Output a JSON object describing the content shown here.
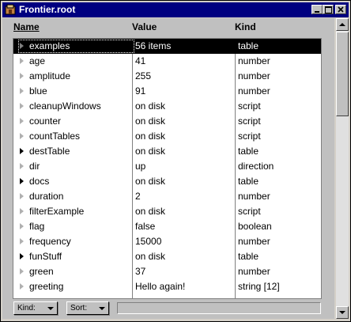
{
  "window": {
    "title": "Frontier.root",
    "title_bg": "#000080",
    "icon": "frontier-app-icon"
  },
  "columns": {
    "name": "Name",
    "value": "Value",
    "kind": "Kind"
  },
  "rows": [
    {
      "name": "examples",
      "value": "56 items",
      "kind": "table",
      "expandable": true,
      "selected": true
    },
    {
      "name": "age",
      "value": "41",
      "kind": "number",
      "expandable": false
    },
    {
      "name": "amplitude",
      "value": "255",
      "kind": "number",
      "expandable": false
    },
    {
      "name": "blue",
      "value": "91",
      "kind": "number",
      "expandable": false
    },
    {
      "name": "cleanupWindows",
      "value": "on disk",
      "kind": "script",
      "expandable": false
    },
    {
      "name": "counter",
      "value": "on disk",
      "kind": "script",
      "expandable": false
    },
    {
      "name": "countTables",
      "value": "on disk",
      "kind": "script",
      "expandable": false
    },
    {
      "name": "destTable",
      "value": "on disk",
      "kind": "table",
      "expandable": true
    },
    {
      "name": "dir",
      "value": "up",
      "kind": "direction",
      "expandable": false
    },
    {
      "name": "docs",
      "value": "on disk",
      "kind": "table",
      "expandable": true
    },
    {
      "name": "duration",
      "value": "2",
      "kind": "number",
      "expandable": false
    },
    {
      "name": "filterExample",
      "value": "on disk",
      "kind": "script",
      "expandable": false
    },
    {
      "name": "flag",
      "value": "false",
      "kind": "boolean",
      "expandable": false
    },
    {
      "name": "frequency",
      "value": "15000",
      "kind": "number",
      "expandable": false
    },
    {
      "name": "funStuff",
      "value": "on disk",
      "kind": "table",
      "expandable": true
    },
    {
      "name": "green",
      "value": "37",
      "kind": "number",
      "expandable": false
    },
    {
      "name": "greeting",
      "value": "Hello again!",
      "kind": "string [12]",
      "expandable": false
    }
  ],
  "bottom": {
    "kind_label": "Kind:",
    "sort_label": "Sort:"
  }
}
